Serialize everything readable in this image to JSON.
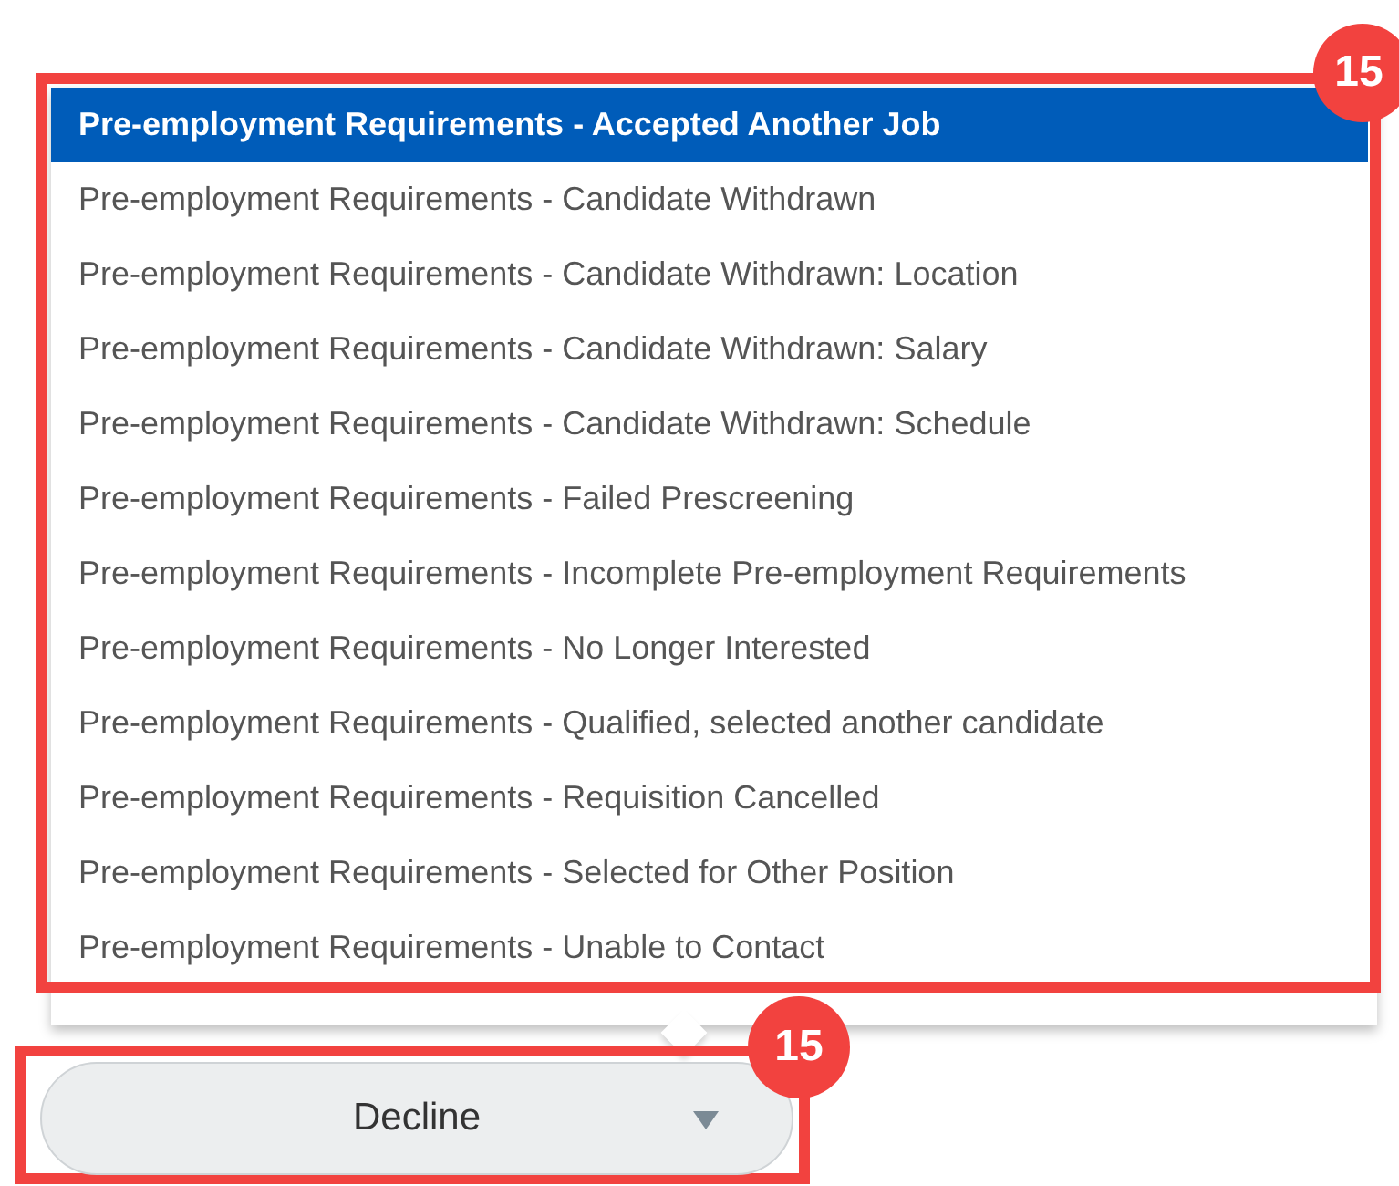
{
  "dropdown": {
    "options": [
      {
        "label": "Pre-employment Requirements - Accepted Another Job",
        "selected": true
      },
      {
        "label": "Pre-employment Requirements - Candidate Withdrawn",
        "selected": false
      },
      {
        "label": "Pre-employment Requirements - Candidate Withdrawn: Location",
        "selected": false
      },
      {
        "label": "Pre-employment Requirements - Candidate Withdrawn: Salary",
        "selected": false
      },
      {
        "label": "Pre-employment Requirements - Candidate Withdrawn: Schedule",
        "selected": false
      },
      {
        "label": "Pre-employment Requirements - Failed Prescreening",
        "selected": false
      },
      {
        "label": "Pre-employment Requirements - Incomplete Pre-employment Requirements",
        "selected": false
      },
      {
        "label": "Pre-employment Requirements - No Longer Interested",
        "selected": false
      },
      {
        "label": "Pre-employment Requirements - Qualified, selected another candidate",
        "selected": false
      },
      {
        "label": "Pre-employment Requirements - Requisition Cancelled",
        "selected": false
      },
      {
        "label": "Pre-employment Requirements - Selected for Other Position",
        "selected": false
      },
      {
        "label": "Pre-employment Requirements - Unable to Contact",
        "selected": false
      }
    ]
  },
  "select": {
    "value": "Decline"
  },
  "callouts": [
    {
      "number": "15"
    },
    {
      "number": "15"
    }
  ]
}
